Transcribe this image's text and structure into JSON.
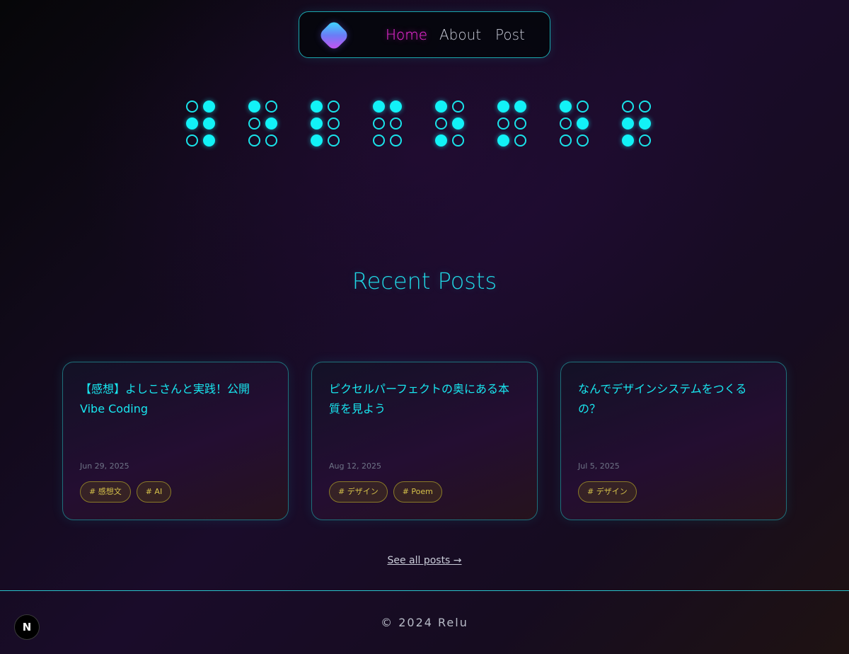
{
  "nav": {
    "links": [
      {
        "label": "Home",
        "active": true
      },
      {
        "label": "About",
        "active": false
      },
      {
        "label": "Post",
        "active": false
      }
    ]
  },
  "braille": {
    "cells": [
      [
        false,
        true,
        true,
        true,
        false,
        true
      ],
      [
        true,
        false,
        false,
        true,
        false,
        false
      ],
      [
        true,
        false,
        true,
        false,
        true,
        false
      ],
      [
        true,
        true,
        false,
        false,
        false,
        false
      ],
      [
        true,
        false,
        false,
        true,
        true,
        false
      ],
      [
        true,
        true,
        false,
        false,
        true,
        false
      ],
      [
        true,
        false,
        false,
        true,
        false,
        false
      ],
      [
        false,
        false,
        true,
        true,
        true,
        false
      ]
    ],
    "dot_color": "#12f2f7"
  },
  "recent": {
    "title": "Recent Posts",
    "posts": [
      {
        "title": "【感想】よしこさんと実践！公開Vibe Coding",
        "date": "Jun 29, 2025",
        "tags": [
          "# 感想文",
          "# AI"
        ]
      },
      {
        "title": "ピクセルパーフェクトの奥にある本質を見よう",
        "date": "Aug 12, 2025",
        "tags": [
          "# デザイン",
          "# Poem"
        ]
      },
      {
        "title": "なんでデザインシステムをつくるの？",
        "date": "Jul 5, 2025",
        "tags": [
          "# デザイン"
        ]
      }
    ],
    "see_all": "See all posts →"
  },
  "footer": {
    "copyright": "© 2024 Relu",
    "badge_letter": "N"
  },
  "colors": {
    "accent_cyan": "#18e6ef",
    "accent_magenta": "#ff2ce6",
    "tag_gold": "#d6c24a"
  }
}
